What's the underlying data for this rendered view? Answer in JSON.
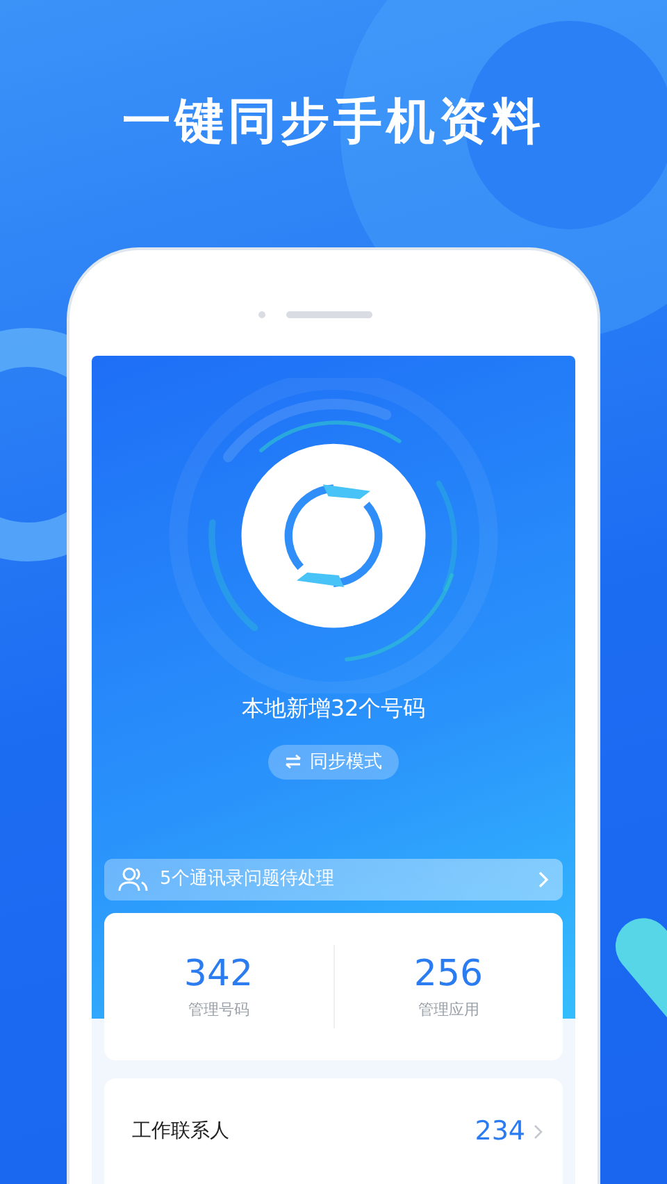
{
  "headline": "一键同步手机资料",
  "status": {
    "text": "本地新增32个号码"
  },
  "mode_button": {
    "label": "同步模式"
  },
  "notice": {
    "text": "5个通讯录问题待处理"
  },
  "stats": [
    {
      "value": "342",
      "label": "管理号码"
    },
    {
      "value": "256",
      "label": "管理应用"
    }
  ],
  "list": [
    {
      "label": "工作联系人",
      "count": "234"
    }
  ]
}
